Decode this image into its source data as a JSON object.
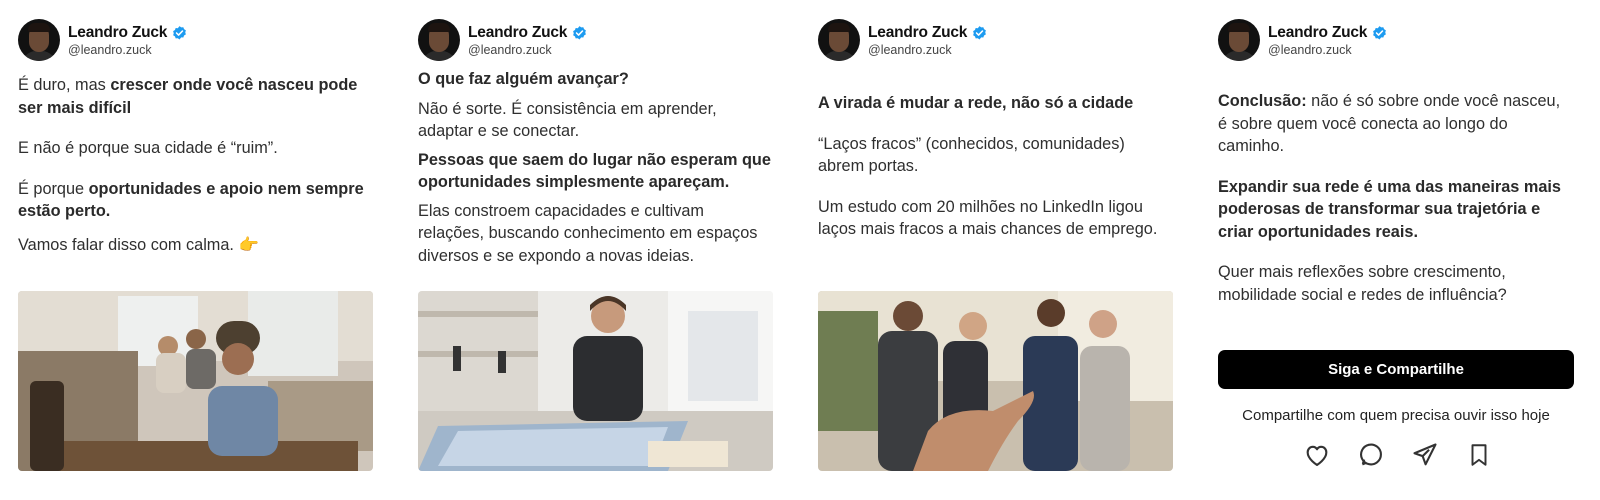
{
  "author": {
    "name": "Leandro Zuck",
    "handle": "@leandro.zuck"
  },
  "colors": {
    "verified": "#1d9bf0",
    "button_bg": "#000000",
    "text": "#2f2f2f"
  },
  "slide1": {
    "p1_a": "É duro, mas ",
    "p1_b": "crescer onde você nasceu pode ser mais difícil",
    "p2": "E não é porque sua cidade é “ruim”.",
    "p3_a": "É porque ",
    "p3_b": "oportunidades e apoio nem sempre estão perto.",
    "p4": "Vamos falar disso com calma. 👉"
  },
  "slide2": {
    "heading": "O que faz alguém avançar?",
    "p1": "Não é sorte. É consistência em aprender, adaptar e se conectar.",
    "p2": "Pessoas que saem do lugar não esperam que oportunidades simplesmente apareçam.",
    "p3": "Elas constroem capacidades e cultivam relações, buscando conhecimento em espaços diversos e se expondo a novas ideias."
  },
  "slide3": {
    "heading": "A virada é mudar a rede, não só a cidade",
    "p1": "“Laços fracos” (conhecidos, comunidades) abrem portas.",
    "p2": "Um estudo com 20 milhões no LinkedIn ligou laços mais fracos a mais chances de emprego."
  },
  "slide4": {
    "p1_a": "Conclusão:",
    "p1_b": " não é só sobre onde você nasceu, é sobre quem você conecta ao longo do caminho.",
    "p2": "Expandir sua rede é uma das maneiras mais poderosas de transformar sua trajetória e criar oportunidades reais.",
    "p3": "Quer mais reflexões sobre crescimento, mobilidade social e redes de influência?",
    "cta_label": "Siga e Compartilhe",
    "share_note": "Compartilhe com quem precisa ouvir isso hoje"
  },
  "icons": [
    "heart-icon",
    "comment-icon",
    "send-icon",
    "bookmark-icon"
  ]
}
